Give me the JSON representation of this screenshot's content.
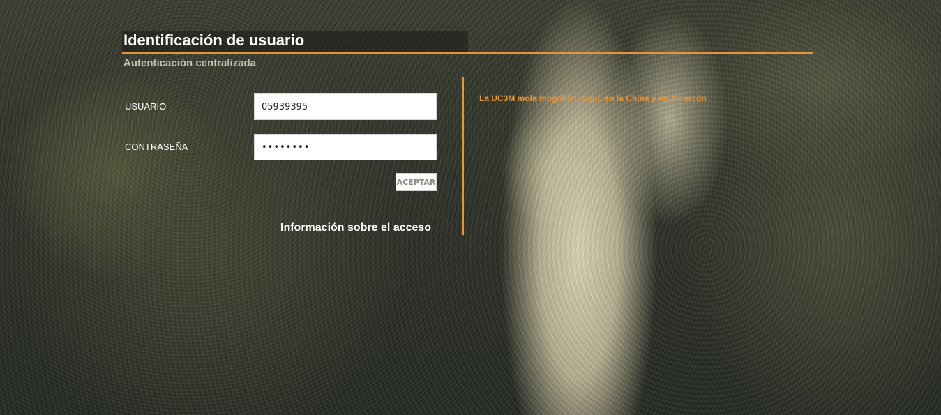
{
  "header": {
    "title": "Identificación de usuario",
    "subtitle": "Autenticación centralizada"
  },
  "login_form": {
    "username_label": "USUARIO",
    "username_value": "05939395",
    "password_label": "CONTRASEÑA",
    "password_value": "••••••••",
    "accept_label": "ACEPTAR",
    "access_info_link": "Información sobre el acceso"
  },
  "side_panel": {
    "notice_text": "La UC3M mola mogollón. Aquí, en la China y en Alcorcón"
  },
  "colors": {
    "accent": "#e8953a",
    "text": "#ffffff",
    "subtitle": "#c9c3b3"
  }
}
